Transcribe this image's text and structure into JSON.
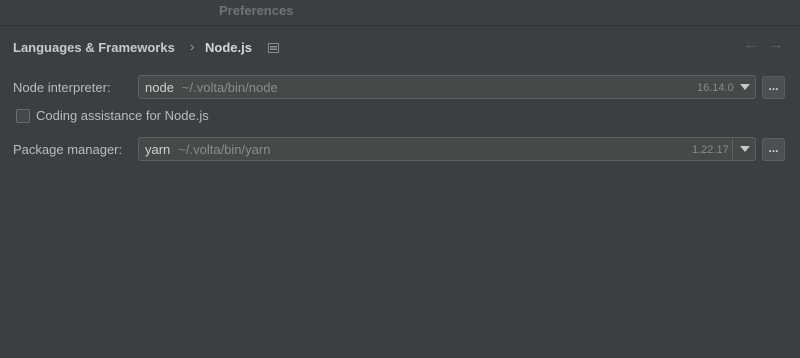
{
  "window": {
    "title": "Preferences"
  },
  "breadcrumb": {
    "parent": "Languages & Frameworks",
    "separator": "›",
    "current": "Node.js"
  },
  "nav": {
    "back_icon": "←",
    "forward_icon": "→"
  },
  "node_interpreter": {
    "label": "Node interpreter:",
    "name": "node",
    "path": "~/.volta/bin/node",
    "version": "16.14.0",
    "browse_label": "..."
  },
  "coding_assistance": {
    "label": "Coding assistance for Node.js",
    "checked": false
  },
  "package_manager": {
    "label": "Package manager:",
    "name": "yarn",
    "path": "~/.volta/bin/yarn",
    "version": "1.22.17",
    "browse_label": "..."
  },
  "colors": {
    "background": "#3c3f41",
    "field": "#45494a",
    "border": "#5e6060",
    "text": "#bbbbbb",
    "muted": "#8c8c8c"
  }
}
